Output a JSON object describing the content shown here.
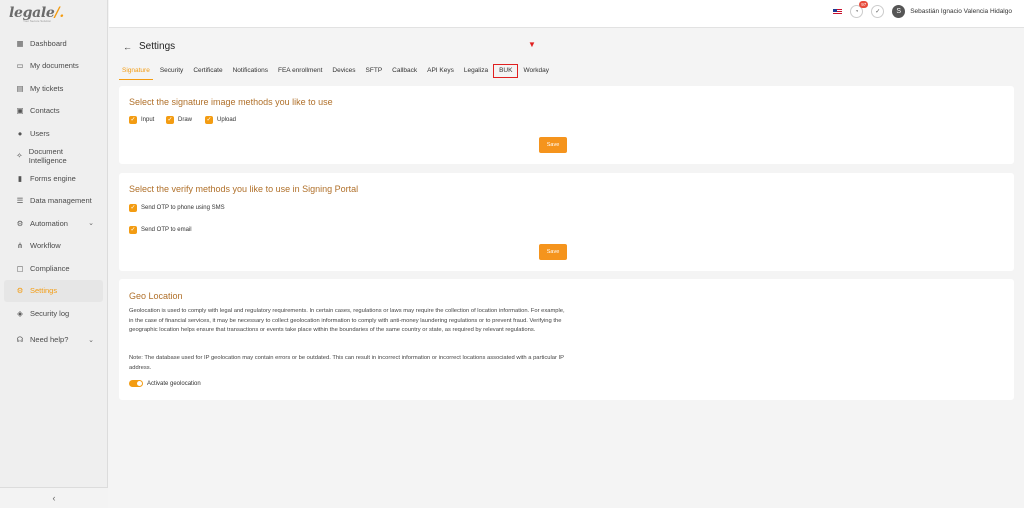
{
  "logo": {
    "name": "legale",
    "tagline": "Your Secure Solution"
  },
  "sidebar": {
    "items": [
      {
        "label": "Dashboard",
        "icon": "dashboard-icon"
      },
      {
        "label": "My documents",
        "icon": "folder-icon"
      },
      {
        "label": "My tickets",
        "icon": "ticket-icon"
      },
      {
        "label": "Contacts",
        "icon": "contacts-icon"
      },
      {
        "label": "Users",
        "icon": "user-icon"
      },
      {
        "label": "Document Intelligence",
        "icon": "sparkle-icon"
      },
      {
        "label": "Forms engine",
        "icon": "form-icon"
      },
      {
        "label": "Data management",
        "icon": "database-icon"
      },
      {
        "label": "Automation",
        "icon": "automation-icon"
      },
      {
        "label": "Workflow",
        "icon": "workflow-icon"
      },
      {
        "label": "Compliance",
        "icon": "compliance-icon"
      },
      {
        "label": "Settings",
        "icon": "gear-icon"
      },
      {
        "label": "Security log",
        "icon": "shield-icon"
      },
      {
        "label": "Need help?",
        "icon": "headset-icon"
      }
    ],
    "collapse_glyph": "‹"
  },
  "topbar": {
    "notification_count": "97",
    "user_name": "Sebastián Ignacio Valencia Hidalgo",
    "avatar_initial": "S"
  },
  "page": {
    "title": "Settings",
    "tabs": [
      "Signature",
      "Security",
      "Certificate",
      "Notifications",
      "FEA enrollment",
      "Devices",
      "SFTP",
      "Callback",
      "API Keys",
      "Legaliza",
      "BUK",
      "Workday"
    ],
    "active_tab": "Signature",
    "highlighted_tab": "BUK"
  },
  "signature_card": {
    "title": "Select the signature image methods you like to use",
    "options": [
      "Input",
      "Draw",
      "Upload"
    ],
    "save_label": "Save"
  },
  "verify_card": {
    "title": "Select the verify methods you like to use in Signing Portal",
    "options": [
      "Send OTP to phone using SMS",
      "Send OTP to email"
    ],
    "save_label": "Save"
  },
  "geo_card": {
    "title": "Geo Location",
    "paragraph": "Geolocation is used to comply with legal and regulatory requirements. In certain cases, regulations or laws may require the collection of location information. For example, in the case of financial services, it may be necessary to collect geolocation information to comply with anti-money laundering regulations or to prevent fraud. Verifying the geographic location helps ensure that transactions or events take place within the boundaries of the same country or state, as required by relevant regulations.",
    "note": "Note: The database used for IP geolocation may contain errors or be outdated. This can result in incorrect information or incorrect locations associated with a particular IP address.",
    "toggle_label": "Activate geolocation"
  },
  "colors": {
    "accent": "#f39c12",
    "title": "#b0702a",
    "highlight": "#e02020"
  }
}
